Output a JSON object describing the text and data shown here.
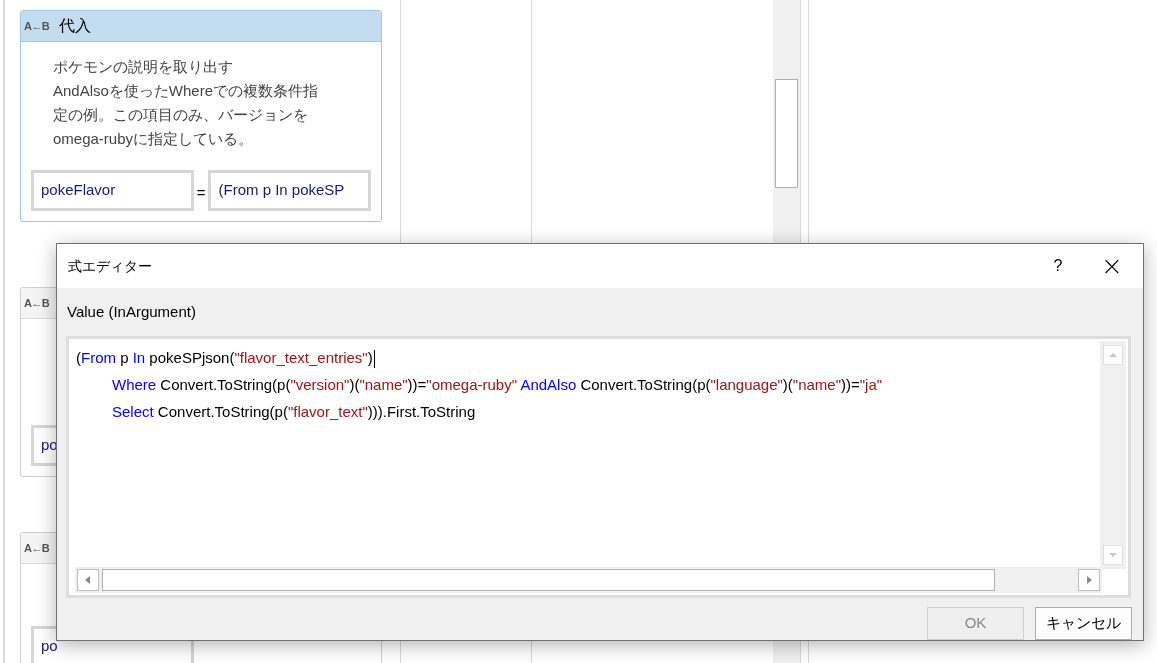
{
  "designer": {
    "cards": [
      {
        "icon": "A←B",
        "title": "代入",
        "description_lines": [
          "ポケモンの説明を取り出す",
          "AndAlsoを使ったWhereでの複数条件指",
          "定の例。この項目のみ、バージョンを",
          "omega-rubyに指定している。"
        ],
        "target": "pokeFlavor",
        "operator": "=",
        "value": "(From p In pokeSP"
      },
      {
        "icon": "A←B",
        "target": "po"
      },
      {
        "icon": "A←B",
        "target": "po"
      }
    ]
  },
  "dialog": {
    "title": "式エディター",
    "help": "?",
    "close": "×",
    "argument_label": "Value (InArgument)",
    "code_lines": [
      {
        "indent": false,
        "tokens": [
          {
            "kind": "plain",
            "text": "("
          },
          {
            "kind": "keyword",
            "text": "From"
          },
          {
            "kind": "plain",
            "text": " p "
          },
          {
            "kind": "keyword",
            "text": "In"
          },
          {
            "kind": "plain",
            "text": " pokeSPjson("
          },
          {
            "kind": "string",
            "text": "\"flavor_text_entries\""
          },
          {
            "kind": "plain",
            "text": ")"
          }
        ],
        "caret": true
      },
      {
        "indent": true,
        "tokens": [
          {
            "kind": "keyword",
            "text": "Where"
          },
          {
            "kind": "plain",
            "text": " Convert.ToString(p("
          },
          {
            "kind": "string",
            "text": "\"version\""
          },
          {
            "kind": "plain",
            "text": ")("
          },
          {
            "kind": "string",
            "text": "\"name\""
          },
          {
            "kind": "plain",
            "text": "))="
          },
          {
            "kind": "string",
            "text": "\"omega-ruby\" "
          },
          {
            "kind": "keyword",
            "text": "AndAlso"
          },
          {
            "kind": "plain",
            "text": " Convert.ToString(p("
          },
          {
            "kind": "string",
            "text": "\"language\""
          },
          {
            "kind": "plain",
            "text": ")("
          },
          {
            "kind": "string",
            "text": "\"name\""
          },
          {
            "kind": "plain",
            "text": "))="
          },
          {
            "kind": "string",
            "text": "\"ja\""
          }
        ],
        "caret": false
      },
      {
        "indent": true,
        "tokens": [
          {
            "kind": "keyword",
            "text": "Select"
          },
          {
            "kind": "plain",
            "text": " Convert.ToString(p("
          },
          {
            "kind": "string",
            "text": "\"flavor_text\""
          },
          {
            "kind": "plain",
            "text": "))).First.ToString"
          }
        ],
        "caret": false
      }
    ],
    "buttons": [
      {
        "label": "OK",
        "disabled": true
      },
      {
        "label": "キャンセル",
        "disabled": false
      }
    ]
  }
}
